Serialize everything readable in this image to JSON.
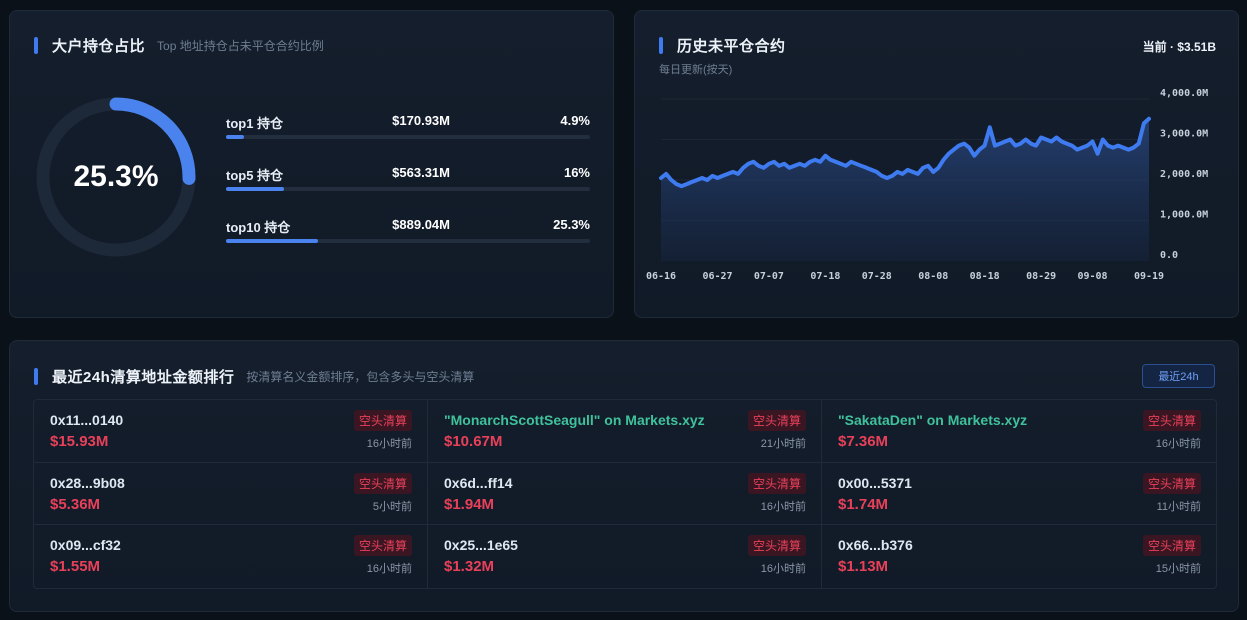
{
  "holders": {
    "title": "大户持仓占比",
    "subtitle": "Top 地址持仓占未平仓合约比例",
    "donut_value": "25.3%",
    "donut_fraction": 0.253,
    "rows": [
      {
        "label": "top1 持仓",
        "value": "$170.93M",
        "pct": "4.9%",
        "fraction": 0.049
      },
      {
        "label": "top5 持仓",
        "value": "$563.31M",
        "pct": "16%",
        "fraction": 0.16
      },
      {
        "label": "top10 持仓",
        "value": "$889.04M",
        "pct": "25.3%",
        "fraction": 0.253
      }
    ],
    "accent": "#4a83ee"
  },
  "open_interest": {
    "title": "历史未平仓合约",
    "subtitle": "每日更新(按天)",
    "current": "当前 · $3.51B",
    "chart_data": {
      "type": "area",
      "x": [
        "06-16",
        "06-17",
        "06-18",
        "06-19",
        "06-20",
        "06-21",
        "06-22",
        "06-23",
        "06-24",
        "06-25",
        "06-26",
        "06-27",
        "06-28",
        "06-29",
        "06-30",
        "07-01",
        "07-02",
        "07-03",
        "07-04",
        "07-05",
        "07-06",
        "07-07",
        "07-08",
        "07-09",
        "07-10",
        "07-11",
        "07-12",
        "07-13",
        "07-14",
        "07-15",
        "07-16",
        "07-17",
        "07-18",
        "07-19",
        "07-20",
        "07-21",
        "07-22",
        "07-23",
        "07-24",
        "07-25",
        "07-26",
        "07-27",
        "07-28",
        "07-29",
        "07-30",
        "07-31",
        "08-01",
        "08-02",
        "08-03",
        "08-04",
        "08-05",
        "08-06",
        "08-07",
        "08-08",
        "08-09",
        "08-10",
        "08-11",
        "08-12",
        "08-13",
        "08-14",
        "08-15",
        "08-16",
        "08-17",
        "08-18",
        "08-19",
        "08-20",
        "08-21",
        "08-22",
        "08-23",
        "08-24",
        "08-25",
        "08-26",
        "08-27",
        "08-28",
        "08-29",
        "08-30",
        "08-31",
        "09-01",
        "09-02",
        "09-03",
        "09-04",
        "09-05",
        "09-06",
        "09-07",
        "09-08",
        "09-09",
        "09-10",
        "09-11",
        "09-12",
        "09-13",
        "09-14",
        "09-15",
        "09-16",
        "09-17",
        "09-18",
        "09-19"
      ],
      "y": [
        2050,
        2150,
        2000,
        1900,
        1850,
        1900,
        1950,
        2000,
        2050,
        2000,
        2100,
        2050,
        2100,
        2150,
        2200,
        2150,
        2300,
        2400,
        2450,
        2350,
        2300,
        2400,
        2450,
        2350,
        2400,
        2300,
        2350,
        2400,
        2350,
        2450,
        2500,
        2450,
        2600,
        2500,
        2450,
        2400,
        2350,
        2450,
        2400,
        2350,
        2300,
        2250,
        2200,
        2100,
        2050,
        2100,
        2200,
        2150,
        2250,
        2200,
        2150,
        2300,
        2350,
        2200,
        2300,
        2500,
        2650,
        2750,
        2850,
        2900,
        2800,
        2600,
        2750,
        2850,
        3300,
        2850,
        2900,
        2950,
        3000,
        2850,
        2900,
        3000,
        2900,
        2850,
        3050,
        3000,
        2950,
        3050,
        2950,
        2900,
        2850,
        2750,
        2800,
        2850,
        2950,
        2650,
        3000,
        2850,
        2800,
        2850,
        2800,
        2750,
        2800,
        2900,
        3400,
        3510
      ],
      "ylim": [
        0,
        4000
      ],
      "yticks": [
        "4,000.0M",
        "3,000.0M",
        "2,000.0M",
        "1,000.0M",
        "0.0"
      ],
      "xticks": [
        "06-16",
        "06-27",
        "07-07",
        "07-18",
        "07-28",
        "08-08",
        "08-18",
        "08-29",
        "09-08",
        "09-19"
      ],
      "line_color": "#3f7bf0",
      "grid": true
    }
  },
  "liquidations": {
    "title": "最近24h清算地址金额排行",
    "subtitle": "按清算名义金额排序，包含多头与空头清算",
    "badge": "最近24h",
    "tag_color": "#e9405a",
    "named_color": "#3fc29c",
    "items": [
      {
        "addr": "0x11...0140",
        "amount": "$15.93M",
        "tag": "空头清算",
        "time": "16小时前",
        "named": false
      },
      {
        "addr": "\"MonarchScottSeagull\" on Markets.xyz",
        "amount": "$10.67M",
        "tag": "空头清算",
        "time": "21小时前",
        "named": true
      },
      {
        "addr": "\"SakataDen\" on Markets.xyz",
        "amount": "$7.36M",
        "tag": "空头清算",
        "time": "16小时前",
        "named": true
      },
      {
        "addr": "0x28...9b08",
        "amount": "$5.36M",
        "tag": "空头清算",
        "time": "5小时前",
        "named": false
      },
      {
        "addr": "0x6d...ff14",
        "amount": "$1.94M",
        "tag": "空头清算",
        "time": "16小时前",
        "named": false
      },
      {
        "addr": "0x00...5371",
        "amount": "$1.74M",
        "tag": "空头清算",
        "time": "11小时前",
        "named": false
      },
      {
        "addr": "0x09...cf32",
        "amount": "$1.55M",
        "tag": "空头清算",
        "time": "16小时前",
        "named": false
      },
      {
        "addr": "0x25...1e65",
        "amount": "$1.32M",
        "tag": "空头清算",
        "time": "16小时前",
        "named": false
      },
      {
        "addr": "0x66...b376",
        "amount": "$1.13M",
        "tag": "空头清算",
        "time": "15小时前",
        "named": false
      }
    ]
  }
}
